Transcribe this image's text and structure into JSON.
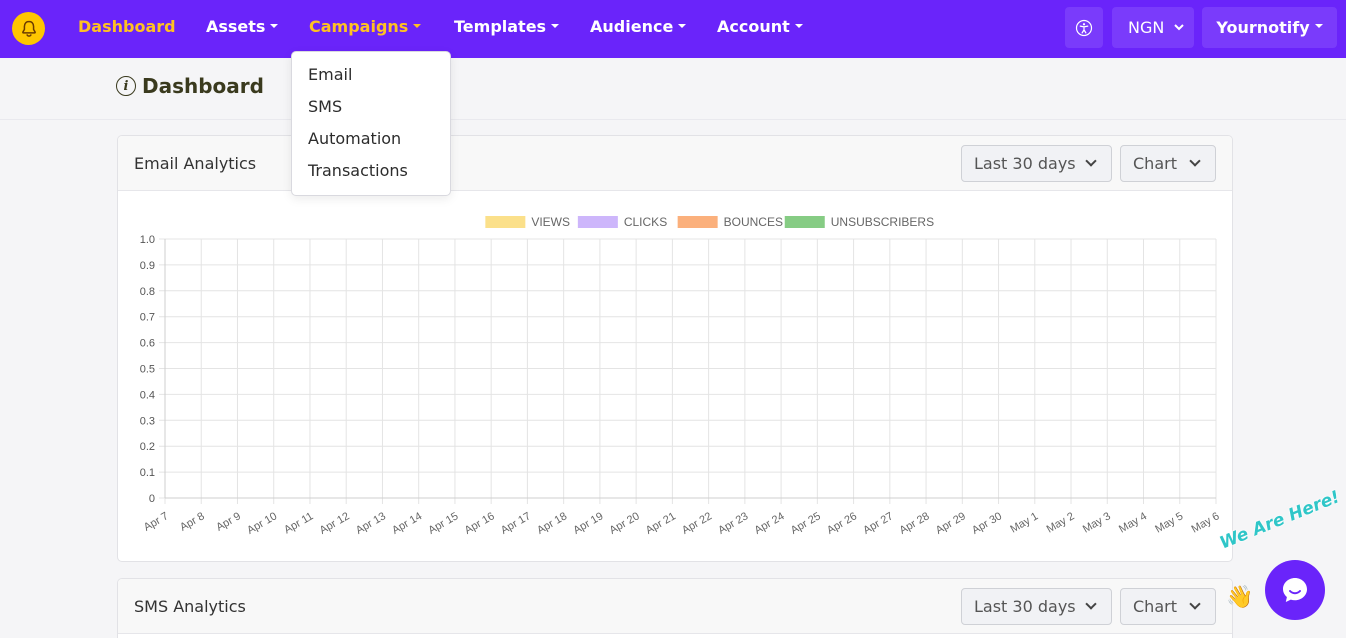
{
  "nav": {
    "links": [
      {
        "label": "Dashboard",
        "active": true
      },
      {
        "label": "Assets",
        "dropdown": true
      },
      {
        "label": "Campaigns",
        "dropdown": true,
        "active_menu": true
      },
      {
        "label": "Templates",
        "dropdown": true
      },
      {
        "label": "Audience",
        "dropdown": true
      },
      {
        "label": "Account",
        "dropdown": true
      }
    ],
    "accessibility_icon": "accessibility-icon",
    "currency": "NGN",
    "user": "Yournotify",
    "colors": {
      "bar": "#6a24fa",
      "active": "#ffc122",
      "logo": "#ffc600"
    }
  },
  "campaigns_menu": {
    "items": [
      "Email",
      "SMS",
      "Automation",
      "Transactions"
    ]
  },
  "page": {
    "title": "Dashboard",
    "icon": "info-icon"
  },
  "email_card": {
    "title": "Email Analytics",
    "range": "Last 30 days",
    "view": "Chart"
  },
  "sms_card": {
    "title": "SMS Analytics",
    "range": "Last 30 days",
    "view": "Chart"
  },
  "chart_data": {
    "type": "line",
    "x": [
      "Apr 7",
      "Apr 8",
      "Apr 9",
      "Apr 10",
      "Apr 11",
      "Apr 12",
      "Apr 13",
      "Apr 14",
      "Apr 15",
      "Apr 16",
      "Apr 17",
      "Apr 18",
      "Apr 19",
      "Apr 20",
      "Apr 21",
      "Apr 22",
      "Apr 23",
      "Apr 24",
      "Apr 25",
      "Apr 26",
      "Apr 27",
      "Apr 28",
      "Apr 29",
      "Apr 30",
      "May 1",
      "May 2",
      "May 3",
      "May 4",
      "May 5",
      "May 6"
    ],
    "yticks": [
      "0",
      "0.1",
      "0.2",
      "0.3",
      "0.4",
      "0.5",
      "0.6",
      "0.7",
      "0.8",
      "0.9",
      "1.0"
    ],
    "ylim": [
      0,
      1
    ],
    "grid": true,
    "legend_position": "top",
    "series": [
      {
        "name": "VIEWS",
        "color": "#fbe08a",
        "values": []
      },
      {
        "name": "CLICKS",
        "color": "#cdb6fb",
        "values": []
      },
      {
        "name": "BOUNCES",
        "color": "#fbb07c",
        "values": []
      },
      {
        "name": "UNSUBSCRIBERS",
        "color": "#86cc84",
        "values": []
      }
    ]
  },
  "chat": {
    "tagline": "We Are Here!",
    "icon": "chat-bubble-icon"
  }
}
